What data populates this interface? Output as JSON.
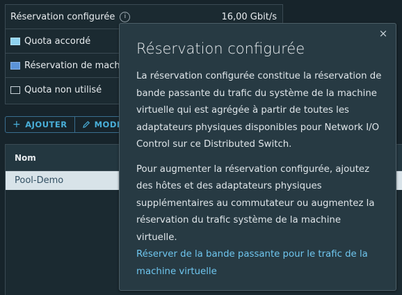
{
  "summary": {
    "rows": [
      {
        "label": "Réservation configurée",
        "value": "16,00 Gbit/s",
        "swatch": null,
        "info": true
      },
      {
        "label": "Quota accordé",
        "swatch": "#8fd3f0"
      },
      {
        "label": "Réservation de machi",
        "swatch": "#5b93d8"
      },
      {
        "label": "Quota non utilisé",
        "swatch": "outline"
      }
    ]
  },
  "toolbar": {
    "add_label": "AJOUTER",
    "modify_label": "MODI"
  },
  "grid": {
    "header": "Nom",
    "rows": [
      {
        "name": "Pool-Demo"
      }
    ]
  },
  "popover": {
    "title": "Réservation configurée",
    "paragraph1": "La réservation configurée constitue la réservation de bande passante du trafic du système de la machine virtuelle qui est agrégée à partir de toutes les adaptateurs physiques disponibles pour Network I/O Control sur ce Distributed Switch.",
    "paragraph2": "Pour augmenter la réservation configurée, ajoutez des hôtes et des adaptateurs physiques supplémentaires au commutateur ou augmentez la réservation du trafic système de la machine virtuelle.",
    "link": "Réserver de la bande passante pour le trafic de la machine virtuelle"
  }
}
